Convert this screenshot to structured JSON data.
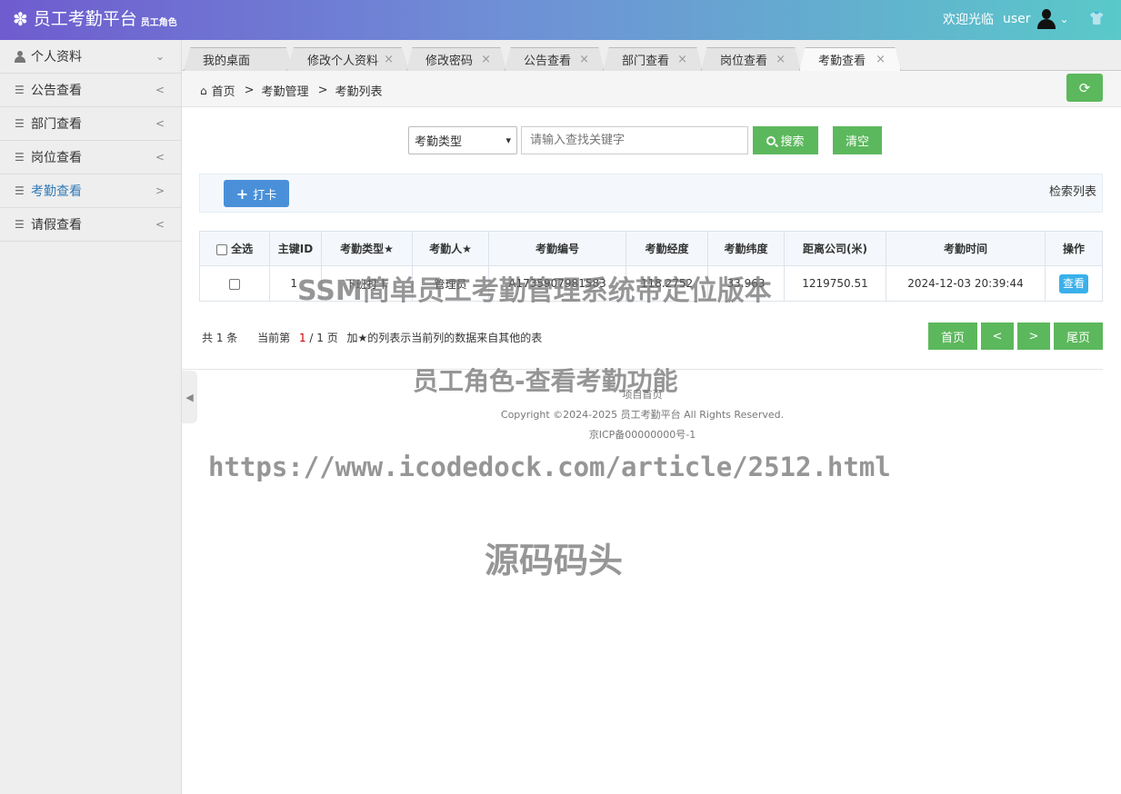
{
  "header": {
    "brand_icon": "✽",
    "title": "员工考勤平台",
    "role": "员工角色",
    "welcome": "欢迎光临",
    "username": "user",
    "chevron": "⌄",
    "shirt_icon": "👕"
  },
  "sidebar": {
    "items": [
      {
        "label": "个人资料",
        "arrow": "⌄"
      },
      {
        "label": "公告查看",
        "arrow": "<"
      },
      {
        "label": "部门查看",
        "arrow": "<"
      },
      {
        "label": "岗位查看",
        "arrow": "<"
      },
      {
        "label": "考勤查看",
        "arrow": ">"
      },
      {
        "label": "请假查看",
        "arrow": "<"
      }
    ]
  },
  "tabs": [
    {
      "label": "我的桌面"
    },
    {
      "label": "修改个人资料",
      "close": "×"
    },
    {
      "label": "修改密码",
      "close": "×"
    },
    {
      "label": "公告查看",
      "close": "×"
    },
    {
      "label": "部门查看",
      "close": "×"
    },
    {
      "label": "岗位查看",
      "close": "×"
    },
    {
      "label": "考勤查看",
      "close": "×"
    }
  ],
  "breadcrumb": {
    "home": "首页",
    "sep": ">",
    "level2": "考勤管理",
    "level3": "考勤列表"
  },
  "search": {
    "select_value": "考勤类型",
    "caret": "▾",
    "placeholder": "请输入查找关键字",
    "search_label": "搜索",
    "clear_label": "清空"
  },
  "actions": {
    "punch_plus": "+",
    "punch_label": "打卡",
    "list_title": "检索列表"
  },
  "table": {
    "headers": {
      "select_all": "全选",
      "id": "主键ID",
      "type": "考勤类型★",
      "person": "考勤人★",
      "code": "考勤编号",
      "lng": "考勤经度",
      "lat": "考勤纬度",
      "distance": "距离公司(米)",
      "time": "考勤时间",
      "op": "操作"
    },
    "rows": [
      {
        "id": "1",
        "type": "下班打卡",
        "person": "管理员",
        "code": "A1735907981583",
        "lng": "118.2752",
        "lat": "33.963",
        "distance": "1219750.51",
        "time": "2024-12-03 20:39:44",
        "view": "查看"
      }
    ]
  },
  "pager": {
    "total": "共 1 条",
    "current_prefix": "当前第",
    "current": "1",
    "pages_suffix": "/ 1 页",
    "note": "加★的列表示当前列的数据来自其他的表",
    "first": "首页",
    "prev": "<",
    "next": ">",
    "last": "尾页"
  },
  "footer": {
    "home": "项目首页",
    "copyright": "Copyright ©2024-2025 员工考勤平台 All Rights Reserved.",
    "icp": "京ICP备00000000号-1"
  },
  "watermarks": {
    "line1": "SSM简单员工考勤管理系统带定位版本",
    "line2": "员工角色-查看考勤功能",
    "url": "https://www.icodedock.com/article/2512.html",
    "brand": "源码码头"
  }
}
